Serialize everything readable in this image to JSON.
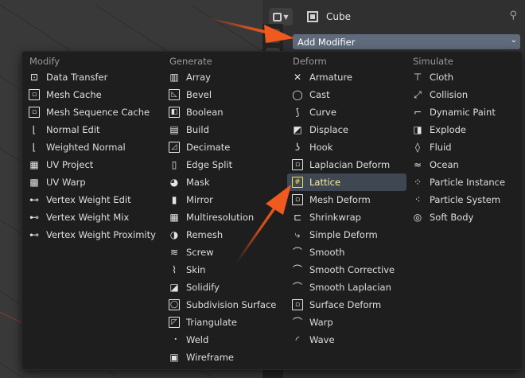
{
  "header": {
    "object_name": "Cube",
    "add_modifier_label": "Add Modifier"
  },
  "menu": {
    "columns": [
      {
        "header": "Modify",
        "items": [
          {
            "label": "Data Transfer",
            "icon": "data-transfer-icon",
            "glyph": "⊡",
            "box": false
          },
          {
            "label": "Mesh Cache",
            "icon": "mesh-cache-icon",
            "glyph": "▫",
            "box": true
          },
          {
            "label": "Mesh Sequence Cache",
            "icon": "mesh-sequence-cache-icon",
            "glyph": "▫",
            "box": true
          },
          {
            "label": "Normal Edit",
            "icon": "normal-edit-icon",
            "glyph": "⌊",
            "box": false
          },
          {
            "label": "Weighted Normal",
            "icon": "weighted-normal-icon",
            "glyph": "⌊",
            "box": false
          },
          {
            "label": "UV Project",
            "icon": "uv-project-icon",
            "glyph": "▦",
            "box": false
          },
          {
            "label": "UV Warp",
            "icon": "uv-warp-icon",
            "glyph": "▩",
            "box": false
          },
          {
            "label": "Vertex Weight Edit",
            "icon": "vertex-weight-edit-icon",
            "glyph": "⊷",
            "box": false
          },
          {
            "label": "Vertex Weight Mix",
            "icon": "vertex-weight-mix-icon",
            "glyph": "⊷",
            "box": false
          },
          {
            "label": "Vertex Weight Proximity",
            "icon": "vertex-weight-proximity-icon",
            "glyph": "⊷",
            "box": false
          }
        ]
      },
      {
        "header": "Generate",
        "items": [
          {
            "label": "Array",
            "icon": "array-icon",
            "glyph": "▥",
            "box": false
          },
          {
            "label": "Bevel",
            "icon": "bevel-icon",
            "glyph": "◺",
            "box": true
          },
          {
            "label": "Boolean",
            "icon": "boolean-icon",
            "glyph": "◧",
            "box": true
          },
          {
            "label": "Build",
            "icon": "build-icon",
            "glyph": "▤",
            "box": false
          },
          {
            "label": "Decimate",
            "icon": "decimate-icon",
            "glyph": "◿",
            "box": true
          },
          {
            "label": "Edge Split",
            "icon": "edge-split-icon",
            "glyph": "▯",
            "box": false
          },
          {
            "label": "Mask",
            "icon": "mask-icon",
            "glyph": "◕",
            "box": false
          },
          {
            "label": "Mirror",
            "icon": "mirror-icon",
            "glyph": "▮",
            "box": false
          },
          {
            "label": "Multiresolution",
            "icon": "multiresolution-icon",
            "glyph": "▦",
            "box": false
          },
          {
            "label": "Remesh",
            "icon": "remesh-icon",
            "glyph": "◑",
            "box": false
          },
          {
            "label": "Screw",
            "icon": "screw-icon",
            "glyph": "≋",
            "box": false
          },
          {
            "label": "Skin",
            "icon": "skin-icon",
            "glyph": "⌇",
            "box": false
          },
          {
            "label": "Solidify",
            "icon": "solidify-icon",
            "glyph": "◪",
            "box": false
          },
          {
            "label": "Subdivision Surface",
            "icon": "subdivision-surface-icon",
            "glyph": "◯",
            "box": true
          },
          {
            "label": "Triangulate",
            "icon": "triangulate-icon",
            "glyph": "◸",
            "box": true
          },
          {
            "label": "Weld",
            "icon": "weld-icon",
            "glyph": "⠐",
            "box": false
          },
          {
            "label": "Wireframe",
            "icon": "wireframe-icon",
            "glyph": "▣",
            "box": false
          }
        ]
      },
      {
        "header": "Deform",
        "items": [
          {
            "label": "Armature",
            "icon": "armature-icon",
            "glyph": "✕",
            "box": false
          },
          {
            "label": "Cast",
            "icon": "cast-icon",
            "glyph": "◯",
            "box": false
          },
          {
            "label": "Curve",
            "icon": "curve-icon",
            "glyph": "⟆",
            "box": false
          },
          {
            "label": "Displace",
            "icon": "displace-icon",
            "glyph": "◩",
            "box": false
          },
          {
            "label": "Hook",
            "icon": "hook-icon",
            "glyph": "ʖ",
            "box": false
          },
          {
            "label": "Laplacian Deform",
            "icon": "laplacian-deform-icon",
            "glyph": "▫",
            "box": true
          },
          {
            "label": "Lattice",
            "icon": "lattice-icon",
            "glyph": "#",
            "box": true,
            "highlighted": true
          },
          {
            "label": "Mesh Deform",
            "icon": "mesh-deform-icon",
            "glyph": "▫",
            "box": true
          },
          {
            "label": "Shrinkwrap",
            "icon": "shrinkwrap-icon",
            "glyph": "⊏",
            "box": false
          },
          {
            "label": "Simple Deform",
            "icon": "simple-deform-icon",
            "glyph": "⤷",
            "box": false
          },
          {
            "label": "Smooth",
            "icon": "smooth-icon",
            "glyph": "⌒",
            "box": false
          },
          {
            "label": "Smooth Corrective",
            "icon": "smooth-corrective-icon",
            "glyph": "⌒",
            "box": false
          },
          {
            "label": "Smooth Laplacian",
            "icon": "smooth-laplacian-icon",
            "glyph": "⌒",
            "box": false
          },
          {
            "label": "Surface Deform",
            "icon": "surface-deform-icon",
            "glyph": "▫",
            "box": true
          },
          {
            "label": "Warp",
            "icon": "warp-icon",
            "glyph": "⌒",
            "box": false
          },
          {
            "label": "Wave",
            "icon": "wave-icon",
            "glyph": "◜",
            "box": false
          }
        ]
      },
      {
        "header": "Simulate",
        "items": [
          {
            "label": "Cloth",
            "icon": "cloth-icon",
            "glyph": "⊤",
            "box": false
          },
          {
            "label": "Collision",
            "icon": "collision-icon",
            "glyph": "⤢",
            "box": false
          },
          {
            "label": "Dynamic Paint",
            "icon": "dynamic-paint-icon",
            "glyph": "⌐",
            "box": false
          },
          {
            "label": "Explode",
            "icon": "explode-icon",
            "glyph": "◨",
            "box": false
          },
          {
            "label": "Fluid",
            "icon": "fluid-icon",
            "glyph": "◊",
            "box": false
          },
          {
            "label": "Ocean",
            "icon": "ocean-icon",
            "glyph": "≈",
            "box": false
          },
          {
            "label": "Particle Instance",
            "icon": "particle-instance-icon",
            "glyph": "⁘",
            "box": false
          },
          {
            "label": "Particle System",
            "icon": "particle-system-icon",
            "glyph": "⁖",
            "box": false
          },
          {
            "label": "Soft Body",
            "icon": "soft-body-icon",
            "glyph": "◎",
            "box": false
          }
        ]
      }
    ]
  },
  "colors": {
    "menu_bg": "#1e1e1e",
    "highlight_bg": "#3f4753",
    "highlight_text": "#fff1a0",
    "add_modifier_bg": "#5f6a7a",
    "arrow": "#e8511a"
  }
}
